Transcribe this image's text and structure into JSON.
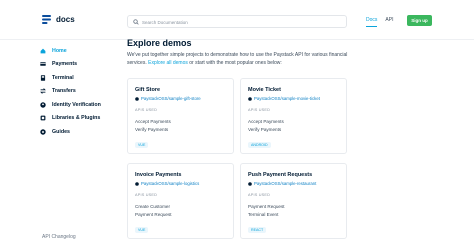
{
  "header": {
    "logo_text": "docs",
    "search_placeholder": "Search Documentation",
    "nav": [
      {
        "label": "Docs",
        "active": true
      },
      {
        "label": "API",
        "active": false
      }
    ],
    "signup_label": "Sign up",
    "accent_color": "#0ba4db",
    "signup_color": "#3bb75e"
  },
  "sidebar": {
    "items": [
      {
        "label": "Home",
        "icon": "home-icon",
        "active": true
      },
      {
        "label": "Payments",
        "icon": "card-icon",
        "active": false
      },
      {
        "label": "Terminal",
        "icon": "terminal-icon",
        "active": false
      },
      {
        "label": "Transfers",
        "icon": "transfer-icon",
        "active": false
      },
      {
        "label": "Identity Verification",
        "icon": "identity-icon",
        "active": false
      },
      {
        "label": "Libraries & Plugins",
        "icon": "plugin-icon",
        "active": false
      },
      {
        "label": "Guides",
        "icon": "guide-icon",
        "active": false
      }
    ],
    "footer_link": "API Changelog"
  },
  "main": {
    "title": "Explore demos",
    "intro_before": "We've put together simple projects to demonstrate how to use the Paystack API for various financial services. ",
    "intro_link": "Explore all demos",
    "intro_after": " or start with the most popular ones below:",
    "apis_used_label": "APIS USED",
    "cards": [
      {
        "title": "Gift Store",
        "repo": "PaystackOSS/sample-gift-store",
        "apis": [
          "Accept Payments",
          "Verify Payments"
        ],
        "tag": "VUE"
      },
      {
        "title": "Movie Ticket",
        "repo": "PaystackOSS/sample-movie-ticket",
        "apis": [
          "Accept Payments",
          "Verify Payments"
        ],
        "tag": "ANDROID"
      },
      {
        "title": "Invoice Payments",
        "repo": "PaystackOSS/sample-logistics",
        "apis": [
          "Create Customer",
          "Payment Request"
        ],
        "tag": "VUE"
      },
      {
        "title": "Push Payment Requests",
        "repo": "PaystackOSS/sample-restaurant",
        "apis": [
          "Payment Request",
          "Terminal Event"
        ],
        "tag": "REACT"
      }
    ]
  }
}
